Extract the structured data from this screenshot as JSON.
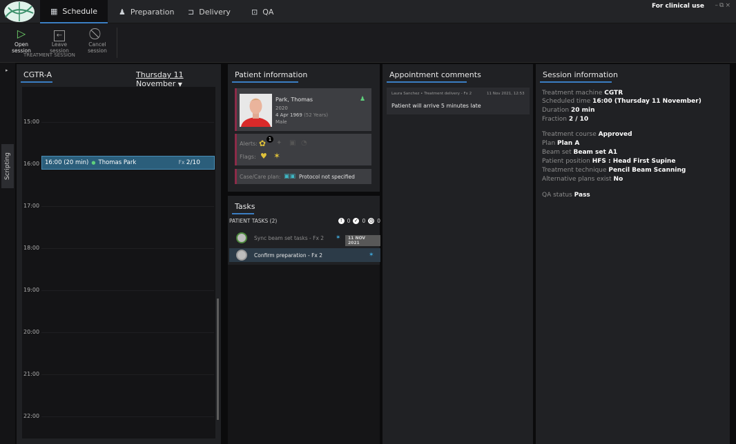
{
  "nav": {
    "tabs": [
      {
        "label": "Schedule",
        "icon": "calendar-icon"
      },
      {
        "label": "Preparation",
        "icon": "person-icon"
      },
      {
        "label": "Delivery",
        "icon": "delivery-icon"
      },
      {
        "label": "QA",
        "icon": "qa-icon"
      }
    ],
    "clinical_use": "For clinical use"
  },
  "toolbar": {
    "open_session": "Open session",
    "leave_session": "Leave session",
    "cancel_session": "Cancel session",
    "group_label": "TREATMENT SESSION"
  },
  "sidebar": {
    "scripting_label": "Scripting"
  },
  "schedule": {
    "machine": "CGTR-A",
    "date": "Thursday 11 November",
    "hours": [
      "15:00",
      "16:00",
      "17:00",
      "18:00",
      "19:00",
      "20:00",
      "21:00",
      "22:00"
    ],
    "appointment": {
      "hour_label": "16:00",
      "time": "16:00 (20 min)",
      "patient": "Thomas Park",
      "fx_label": "Fx",
      "fx_value": "2/10"
    }
  },
  "patient_info": {
    "title": "Patient information",
    "name": "Park, Thomas",
    "id": "2020",
    "birth": "4 Apr 1969",
    "age": "(52 Years)",
    "gender": "Male",
    "alerts_label": "Alerts:",
    "alerts_count": "1",
    "flags_label": "Flags:",
    "care_plan_label": "Case/Care plan:",
    "protocol": "Protocol not specified"
  },
  "tasks": {
    "title": "Tasks",
    "header": "PATIENT TASKS (2)",
    "counts": [
      "0",
      "0",
      "0"
    ],
    "items": [
      {
        "label": "Sync beam set tasks - Fx 2",
        "date": "11 NOV 2021"
      },
      {
        "label": "Confirm preparation - Fx 2",
        "date": ""
      }
    ]
  },
  "appointment_comments": {
    "title": "Appointment comments",
    "author": "Laura Sanchez",
    "context": "Treatment delivery - Fx 2",
    "timestamp": "11 Nov 2021, 12:53",
    "text": "Patient will arrive 5 minutes late"
  },
  "session_info": {
    "title": "Session information",
    "rows": [
      {
        "label": "Treatment machine",
        "value": "CGTR"
      },
      {
        "label": "Scheduled time",
        "value": "16:00 (Thursday 11 November)"
      },
      {
        "label": "Duration",
        "value": "20 min"
      },
      {
        "label": "Fraction",
        "value": "2 / 10"
      },
      {
        "label": "Treatment course",
        "value": "Approved"
      },
      {
        "label": "Plan",
        "value": "Plan A"
      },
      {
        "label": "Beam set",
        "value": "Beam set A1"
      },
      {
        "label": "Patient position",
        "value": "HFS : Head First Supine"
      },
      {
        "label": "Treatment technique",
        "value": "Pencil Beam Scanning"
      },
      {
        "label": "Alternative plans exist",
        "value": "No"
      },
      {
        "label": "QA status",
        "value": "Pass"
      }
    ]
  },
  "colors": {
    "accent": "#3b7fc4",
    "appointment": "#2b5e7b",
    "open_session": "#6fd06a",
    "alert": "#e0c23a",
    "flag_pink": "#8c2b48"
  }
}
